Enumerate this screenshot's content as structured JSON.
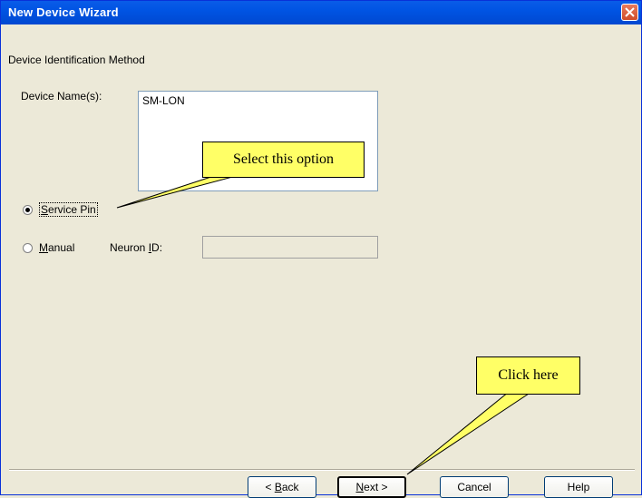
{
  "window": {
    "title": "New Device Wizard"
  },
  "section_title": "Device Identification Method",
  "device_names": {
    "label": "Device Name(s):",
    "value": "SM-LON"
  },
  "options": {
    "service_pin": {
      "label": "Service Pin",
      "selected": true
    },
    "manual": {
      "label": "Manual",
      "selected": false
    },
    "neuron_id_label": "Neuron ID:",
    "neuron_id_value": ""
  },
  "buttons": {
    "back": "< Back",
    "next": "Next >",
    "cancel": "Cancel",
    "help": "Help"
  },
  "callouts": {
    "select_option": "Select this option",
    "click_here": "Click here"
  },
  "colors": {
    "callout_fill": "#ffff66",
    "title_bar": "#0054e3",
    "dialog_bg": "#ece9d8"
  }
}
